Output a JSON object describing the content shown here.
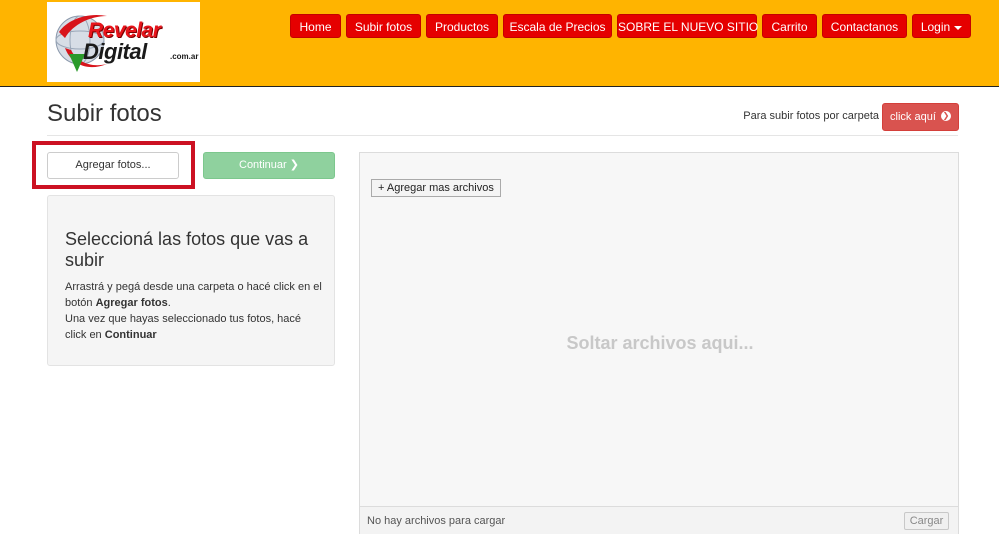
{
  "header": {
    "logo": {
      "line1": "Revelar",
      "line2": "Digital",
      "suffix": ".com.ar"
    },
    "nav": [
      {
        "label": "Home"
      },
      {
        "label": "Subir fotos"
      },
      {
        "label": "Productos"
      },
      {
        "label": "Escala de Precios"
      },
      {
        "label": "SOBRE EL NUEVO SITIO"
      },
      {
        "label": "Carrito"
      },
      {
        "label": "Contactanos"
      },
      {
        "label": "Login"
      }
    ]
  },
  "page": {
    "title": "Subir fotos",
    "folder_text": "Para subir fotos por carpeta",
    "folder_button": "click aquí"
  },
  "left": {
    "add_button": "Agregar fotos...",
    "continue_button": "Continuar",
    "info_heading": "Seleccioná las fotos que vas a subir",
    "info_line1": "Arrastrá y pegá desde una carpeta o hacé click en el botón",
    "info_bold1": "Agregar fotos",
    "info_line2": "Una vez que hayas seleccionado tus fotos, hacé click en",
    "info_bold2": "Continuar"
  },
  "dropzone": {
    "add_more": "+ Agregar mas archivos",
    "drop_text": "Soltar archivos aqui...",
    "status": "No hay archivos para cargar",
    "upload_button": "Cargar"
  },
  "colors": {
    "header_bg": "#ffb400",
    "nav_button": "#e50000",
    "danger_button": "#d9534f",
    "success_button_disabled": "#8fd19e",
    "highlight_border": "#cc1122"
  }
}
